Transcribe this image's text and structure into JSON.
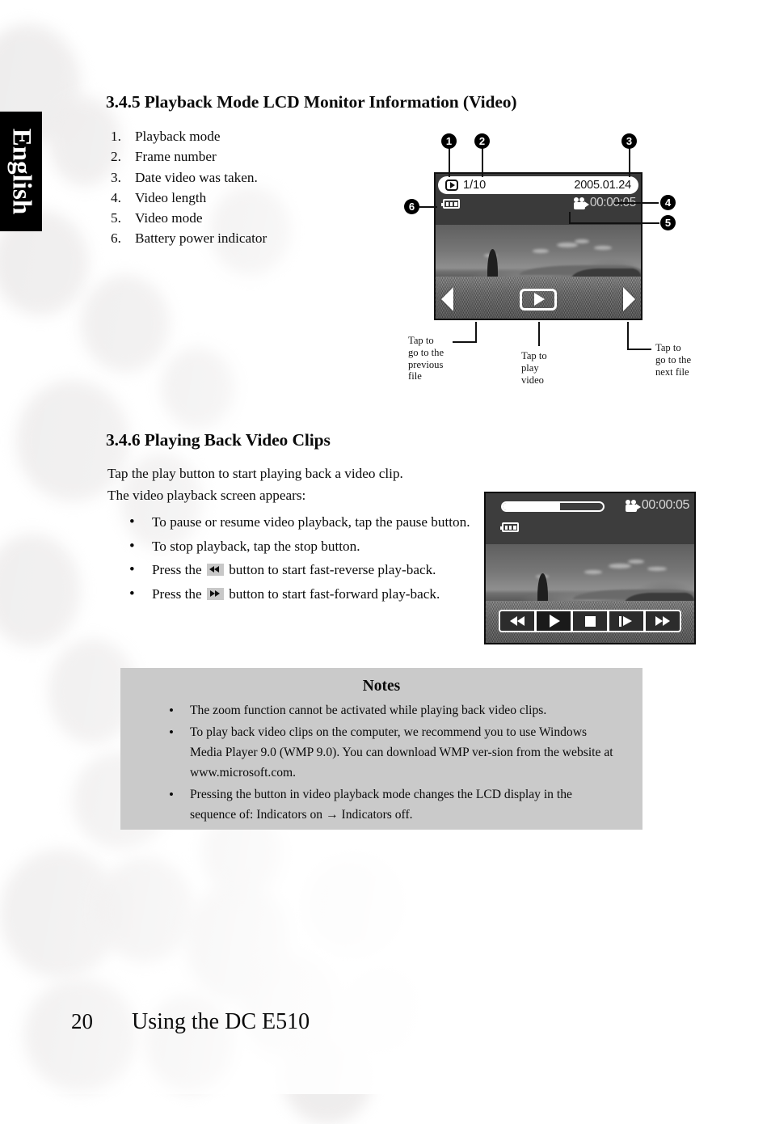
{
  "sidebar": {
    "language_tab": "English"
  },
  "section_345": {
    "heading": "3.4.5 Playback Mode LCD Monitor Information (Video)",
    "items": [
      {
        "num": "1.",
        "label": "Playback mode"
      },
      {
        "num": "2.",
        "label": "Frame number"
      },
      {
        "num": "3.",
        "label": "Date video was taken."
      },
      {
        "num": "4.",
        "label": "Video length"
      },
      {
        "num": "5.",
        "label": "Video mode"
      },
      {
        "num": "6.",
        "label": "Battery power indicator"
      }
    ],
    "lcd": {
      "playback_icon": "play-badge-icon",
      "frame_number": "1/10",
      "date": "2005.01.24",
      "video_length": "00:00:05",
      "video_mode_icon": "camcorder-icon",
      "battery_icon": "battery-full-icon",
      "prev_icon": "chevron-left-icon",
      "play_icon": "play-icon",
      "next_icon": "chevron-right-icon"
    },
    "callouts": [
      "1",
      "2",
      "3",
      "4",
      "5",
      "6"
    ],
    "tap_captions": {
      "prev": "Tap to\ngo to the\nprevious\nfile",
      "play": "Tap to\nplay\nvideo",
      "next": "Tap to\ngo to the\nnext file"
    }
  },
  "section_346": {
    "heading": "3.4.6 Playing Back Video Clips",
    "intro_line1": "Tap the play button to start playing back a video clip.",
    "intro_line2": "The video playback screen appears:",
    "bullets": [
      {
        "pre": "To pause or resume video playback, tap the pause button.",
        "icon": null,
        "post": ""
      },
      {
        "pre": "To stop playback, tap the stop button.",
        "icon": null,
        "post": ""
      },
      {
        "pre": "Press the ",
        "icon": "fast-reverse-icon",
        "post": " button to start fast-reverse play-back."
      },
      {
        "pre": "Press the ",
        "icon": "fast-forward-icon",
        "post": " button to start fast-forward play-back."
      }
    ],
    "playback_lcd": {
      "progress_percent": 57,
      "video_length": "00:00:05",
      "video_mode_icon": "camcorder-icon",
      "battery_icon": "battery-full-icon",
      "controls": [
        {
          "name": "fast-reverse-button",
          "icon": "fast-reverse-icon",
          "active": false
        },
        {
          "name": "play-button",
          "icon": "play-icon",
          "active": true
        },
        {
          "name": "stop-button",
          "icon": "stop-icon",
          "active": false
        },
        {
          "name": "step-forward-button",
          "icon": "step-forward-icon",
          "active": false
        },
        {
          "name": "fast-forward-button",
          "icon": "fast-forward-icon",
          "active": false
        }
      ]
    }
  },
  "notes": {
    "title": "Notes",
    "items": [
      "The zoom function cannot be activated while playing back video clips.",
      "To play back video clips on the computer, we recommend you to use Windows Media Player 9.0 (WMP 9.0). You can download WMP ver-sion from the website at www.microsoft.com.",
      "Pressing the button in video playback mode changes the LCD display in the sequence of: Indicators on → Indicators off."
    ]
  },
  "footer": {
    "page_number": "20",
    "title": "Using the DC E510"
  },
  "colors": {
    "notes_background": "#cacaca",
    "tab_background": "#000000",
    "lcd_background": "#3a3a3a",
    "text": "#0b0b0b"
  }
}
